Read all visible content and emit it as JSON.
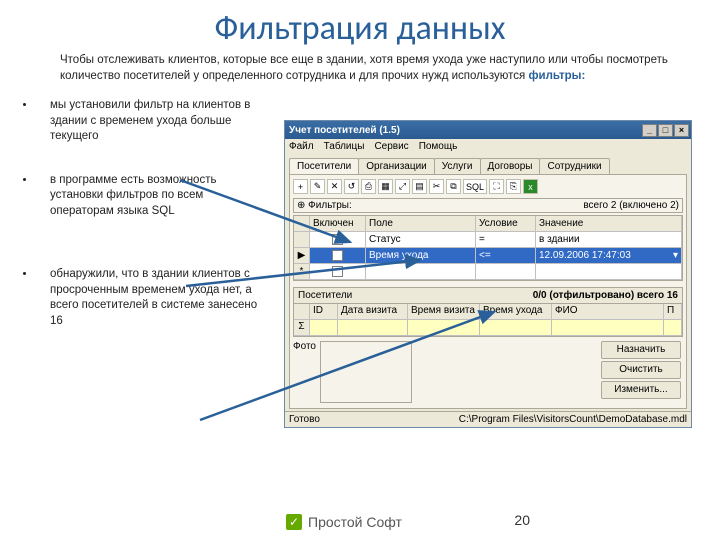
{
  "slide": {
    "title": "Фильтрация данных",
    "intro_pre": "Чтобы отслеживать клиентов, которые все еще в здании, хотя время ухода уже наступило или чтобы посмотреть количество посетителей у определенного сотрудника и для прочих нужд используются ",
    "intro_hl": "фильтры:",
    "bullets": [
      "мы установили фильтр на клиентов в здании с временем ухода больше текущего",
      "в программе есть возможность установки фильтров по всем операторам языка SQL",
      "обнаружили, что в здании клиентов с просроченным временем ухода нет, а всего посетителей в системе занесено 16"
    ],
    "page_num": "20",
    "brand": "Простой Софт"
  },
  "app": {
    "title": "Учет посетителей (1.5)",
    "menu": [
      "Файл",
      "Таблицы",
      "Сервис",
      "Помощь"
    ],
    "tabs": [
      "Посетители",
      "Организации",
      "Услуги",
      "Договоры",
      "Сотрудники"
    ],
    "filters_label": "Фильтры:",
    "filters_count": "всего 2 (включено 2)",
    "filter_cols": [
      "Включен",
      "Поле",
      "Условие",
      "Значение"
    ],
    "filter_rows": [
      {
        "on": true,
        "field": "Статус",
        "cond": "=",
        "val": "в здании"
      },
      {
        "on": true,
        "field": "Время ухода",
        "cond": "<=",
        "val": "12.09.2006 17:47:03"
      }
    ],
    "visitors_label": "Посетители",
    "visitors_count": "0/0 (отфильтровано)  всего 16",
    "visitor_cols": [
      "",
      "ID",
      "Дата визита",
      "Время визита",
      "Время ухода",
      "ФИО",
      "П"
    ],
    "photo_label": "Фото",
    "buttons": {
      "assign": "Назначить",
      "clear": "Очистить",
      "edit": "Изменить..."
    },
    "status_ready": "Готово",
    "status_path": "C:\\Program Files\\VisitorsCount\\DemoDatabase.mdl",
    "toolbar_icons": [
      "+",
      "✎",
      "✕",
      "↺",
      "⎙",
      "▦",
      "⤢",
      "▤",
      "✂",
      "⧉",
      "SQL",
      "⛶",
      "⎘",
      "x"
    ],
    "sigma": "Σ"
  }
}
